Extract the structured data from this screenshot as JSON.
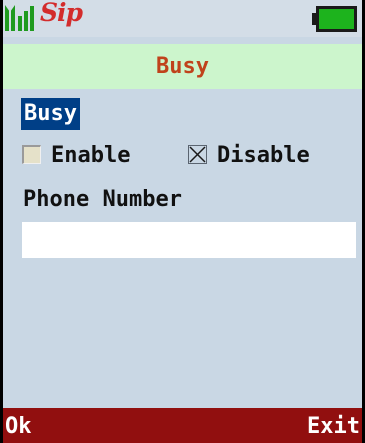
{
  "status_bar": {
    "signal_icon": "signal-strength-icon",
    "sip_logo": "Sip",
    "battery_icon": "battery-icon",
    "battery_level": 0.85
  },
  "title": "Busy",
  "section_label": "Busy",
  "options": {
    "enable": {
      "label": "Enable",
      "checked": false
    },
    "disable": {
      "label": "Disable",
      "checked": true
    }
  },
  "phone_number": {
    "label": "Phone Number",
    "value": ""
  },
  "softkeys": {
    "left": "Ok",
    "right": "Exit"
  },
  "colors": {
    "screen_bg": "#c9d7e4",
    "title_bg": "#ccf5cc",
    "title_text": "#c0421b",
    "selection_bg": "#003f87",
    "softkey_bg": "#910f0f",
    "signal": "#1f9a1f",
    "battery": "#1db31d",
    "sip_logo": "#d32c2c"
  }
}
